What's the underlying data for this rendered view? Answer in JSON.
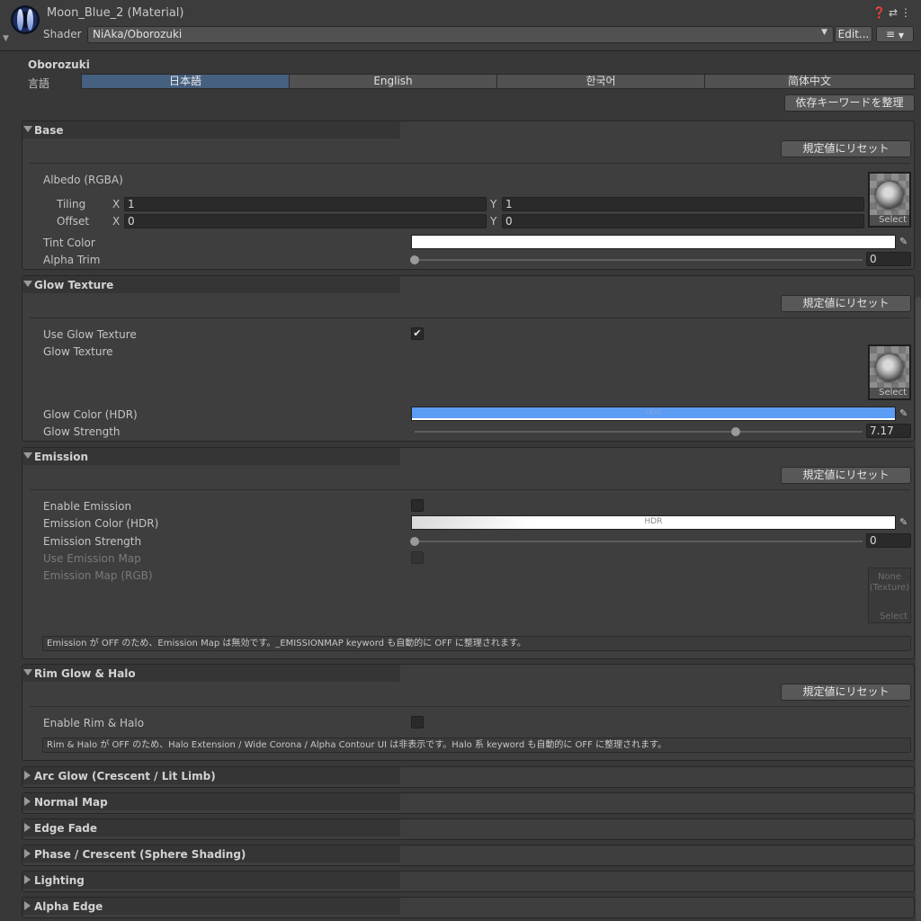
{
  "header": {
    "title": "Moon_Blue_2 (Material)",
    "icons": [
      "help-icon",
      "preset-icon",
      "overflow-menu-icon"
    ],
    "shader_label": "Shader",
    "shader_value": "NiAka/Oborozuki",
    "edit_label": "Edit...",
    "list_icon": "≡"
  },
  "panel": {
    "title": "Oborozuki",
    "language_label": "言語",
    "languages": [
      "日本語",
      "English",
      "한국어",
      "简体中文"
    ],
    "selected_language": "日本語",
    "organize_keywords_label": "依存キーワードを整理"
  },
  "sections": {
    "base": {
      "title": "Base",
      "reset_label": "規定値にリセット",
      "albedo_label": "Albedo (RGBA)",
      "tiling_label": "Tiling",
      "offset_label": "Offset",
      "x_label": "X",
      "y_label": "Y",
      "tiling_x": "1",
      "tiling_y": "1",
      "offset_x": "0",
      "offset_y": "0",
      "select_label": "Select",
      "tint_label": "Tint Color",
      "tint_color": "#ffffff",
      "alpha_trim_label": "Alpha Trim",
      "alpha_trim_value": "0",
      "alpha_trim_fraction": 0.0
    },
    "glow_texture": {
      "title": "Glow Texture",
      "reset_label": "規定値にリセット",
      "use_label": "Use Glow Texture",
      "use_checked": true,
      "texture_label": "Glow Texture",
      "select_label": "Select",
      "color_label": "Glow Color (HDR)",
      "color": "#5b9cf5",
      "hdr_label": "HDR",
      "strength_label": "Glow Strength",
      "strength_value": "7.17",
      "strength_fraction": 0.717
    },
    "emission": {
      "title": "Emission",
      "reset_label": "規定値にリセット",
      "enable_label": "Enable Emission",
      "enable_checked": false,
      "color_label": "Emission Color (HDR)",
      "hdr_label": "HDR",
      "strength_label": "Emission Strength",
      "strength_value": "0",
      "strength_fraction": 0.0,
      "use_map_label": "Use Emission Map",
      "map_label": "Emission Map (RGB)",
      "none_label": "None\n(Texture)",
      "select_label": "Select",
      "help_text": "Emission が OFF のため、Emission Map は無効です。_EMISSIONMAP keyword も自動的に OFF に整理されます。"
    },
    "rim": {
      "title": "Rim Glow & Halo",
      "reset_label": "規定値にリセット",
      "enable_label": "Enable Rim & Halo",
      "enable_checked": false,
      "help_text": "Rim & Halo が OFF のため、Halo Extension / Wide Corona / Alpha Contour UI は非表示です。Halo 系 keyword も自動的に OFF に整理されます。"
    },
    "collapsed": [
      "Arc Glow (Crescent / Lit Limb)",
      "Normal Map",
      "Edge Fade",
      "Phase / Crescent (Sphere Shading)",
      "Lighting",
      "Alpha Edge"
    ]
  }
}
